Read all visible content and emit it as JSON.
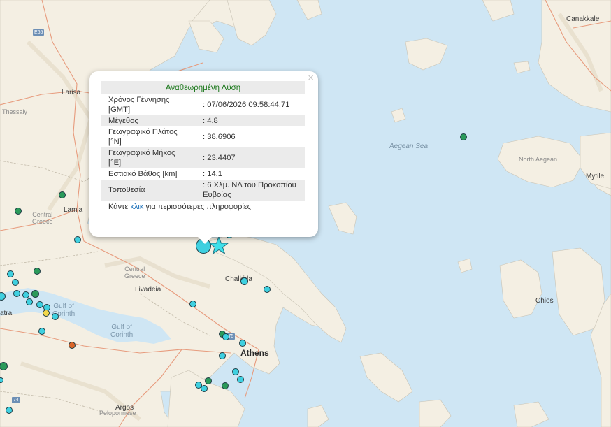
{
  "map": {
    "place_labels": [
      {
        "text": "Larisa",
        "cls": "city"
      },
      {
        "text": "Thessaly",
        "cls": "region"
      },
      {
        "text": "Lamia",
        "cls": "city"
      },
      {
        "text": "Central\nGreece",
        "cls": "region"
      },
      {
        "text": "Central\nGreece",
        "cls": "region"
      },
      {
        "text": "Livadeia",
        "cls": "city"
      },
      {
        "text": "Chalkida",
        "cls": "city"
      },
      {
        "text": "Athens",
        "cls": "big"
      },
      {
        "text": "Gulf of\nCorinth",
        "cls": "gulf"
      },
      {
        "text": "Gulf of\nCorinth",
        "cls": "gulf"
      },
      {
        "text": "atra",
        "cls": "city"
      },
      {
        "text": "Peloponnese",
        "cls": "region"
      },
      {
        "text": "Argos",
        "cls": "city"
      },
      {
        "text": "Aegean Sea",
        "cls": "sea"
      },
      {
        "text": "North Aegean",
        "cls": "region"
      },
      {
        "text": "Chios",
        "cls": "city"
      },
      {
        "text": "Canakkale",
        "cls": "city"
      },
      {
        "text": "Mytile",
        "cls": "city"
      },
      {
        "text": "E65",
        "cls": "road"
      },
      {
        "text": "E75",
        "cls": "road"
      },
      {
        "text": "74",
        "cls": "road"
      }
    ],
    "colors": {
      "sea": "#cfe6f4",
      "land": "#f4efe3",
      "eq_cyan": "#3fd0e0",
      "eq_green": "#2a9a5a",
      "eq_orange": "#d9662a",
      "eq_yellow": "#f2d64a",
      "star": "#3fe0ea"
    },
    "epicenter_icon": "star-icon"
  },
  "popup": {
    "title": "Αναθεωρημένη Λύση",
    "close_icon": "close-icon",
    "close_symbol": "×",
    "rows": [
      {
        "label": "Χρόνος Γέννησης [GMT]",
        "value": ": 07/06/2026 09:58:44.71"
      },
      {
        "label": "Μέγεθος",
        "value": ": 4.8"
      },
      {
        "label": "Γεωγραφικό Πλάτος [°N]",
        "value": ": 38.6906"
      },
      {
        "label": "Γεωγραφικό Μήκος [°E]",
        "value": ": 23.4407"
      },
      {
        "label": "Εστιακό Βάθος [km]",
        "value": ": 14.1"
      },
      {
        "label": "Τοποθεσία",
        "value": ": 6 Χλμ. ΝΔ του Προκοπίου Ευβοίας"
      }
    ],
    "footer_before": "Κάντε ",
    "footer_link": "κλικ",
    "footer_after": " για περισσότερες πληροφορίες"
  }
}
